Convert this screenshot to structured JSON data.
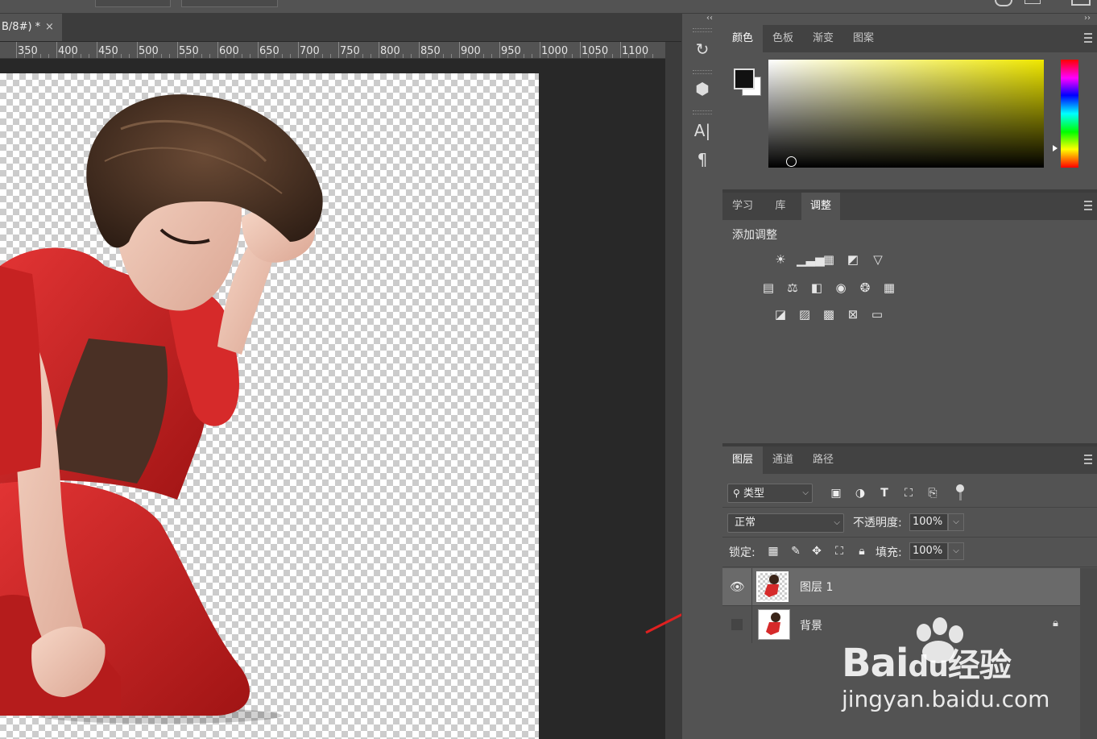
{
  "document": {
    "tab_title": "B/8#) *",
    "close_glyph": "×"
  },
  "ruler": {
    "labels": [
      "350",
      "400",
      "450",
      "500",
      "550",
      "600",
      "650",
      "700",
      "750",
      "800",
      "850",
      "900",
      "950",
      "1000",
      "1050",
      "1100"
    ]
  },
  "icon_strip": {
    "icons": [
      "history-icon",
      "3d-icon",
      "character-icon",
      "paragraph-icon"
    ],
    "collapse_glyph": "‹‹",
    "expand_glyph": "››"
  },
  "color_panel": {
    "tabs": [
      "颜色",
      "色板",
      "渐变",
      "图案"
    ],
    "active_tab": "颜色",
    "foreground": "#111111",
    "background": "#ffffff",
    "hue_color": "#f0e800"
  },
  "adjustments_panel": {
    "tabs": [
      "学习",
      "库",
      "调整"
    ],
    "active_tab": "调整",
    "heading": "添加调整",
    "row1": [
      "brightness-contrast-icon",
      "levels-icon",
      "curves-icon",
      "exposure-icon",
      "vibrance-icon"
    ],
    "row2": [
      "hue-saturation-icon",
      "color-balance-icon",
      "black-white-icon",
      "photo-filter-icon",
      "channel-mixer-icon",
      "color-lookup-icon"
    ],
    "row3": [
      "invert-icon",
      "posterize-icon",
      "threshold-icon",
      "selective-color-icon",
      "gradient-map-icon"
    ]
  },
  "layers_panel": {
    "tabs": [
      "图层",
      "通道",
      "路径"
    ],
    "active_tab": "图层",
    "filter_label": "类型",
    "blend_mode": "正常",
    "opacity_label": "不透明度:",
    "opacity_value": "100%",
    "lock_label": "锁定:",
    "fill_label": "填充:",
    "fill_value": "100%",
    "layers": [
      {
        "name": "图层 1",
        "visible": true,
        "selected": true,
        "locked": false
      },
      {
        "name": "背景",
        "visible": false,
        "selected": false,
        "locked": true
      }
    ]
  },
  "watermark": {
    "brand_part1": "Bai",
    "brand_part2": "du",
    "brand_cn": "经验",
    "url": "jingyan.baidu.com"
  },
  "colors": {
    "panel_bg": "#535353",
    "tab_bar": "#424242",
    "selected_layer": "#6a6a6a",
    "arrow": "#e02020"
  }
}
